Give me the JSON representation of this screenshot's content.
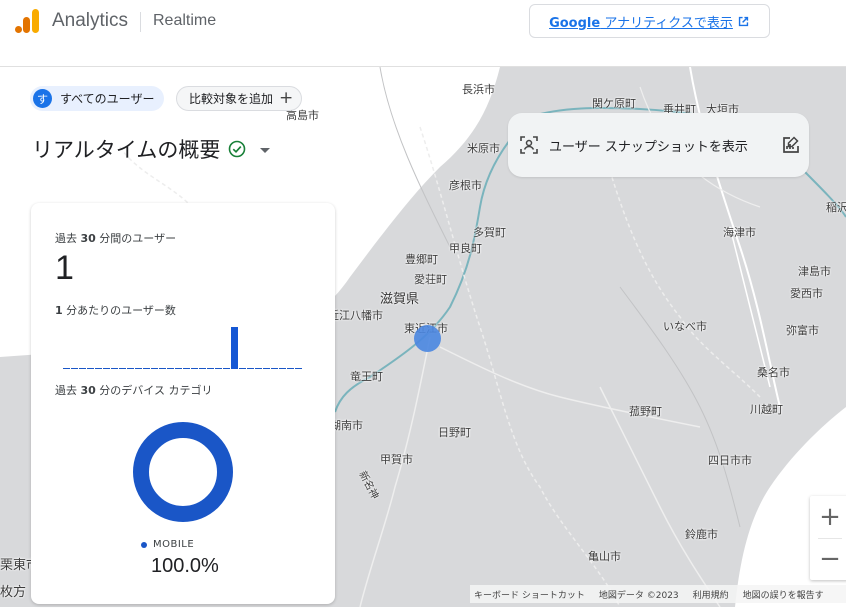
{
  "header": {
    "app_name": "Analytics",
    "view_name": "Realtime",
    "ga_link_bold": "Google",
    "ga_link_rest": " アナリティクスで表示"
  },
  "chips": {
    "all_users_avatar": "す",
    "all_users_label": "すべてのユーザー",
    "add_comparison_label": "比較対象を追加"
  },
  "page": {
    "title": "リアルタイムの概要"
  },
  "snapshot": {
    "label": "ユーザー スナップショットを表示"
  },
  "card": {
    "users_label_pre": "過去 ",
    "users_label_num": "30",
    "users_label_post": " 分間のユーザー",
    "users_value": "1",
    "per_min_num": "1",
    "per_min_label": " 分あたりのユーザー数",
    "device_label_pre": "過去 ",
    "device_label_num": "30",
    "device_label_post": " 分のデバイス カテゴリ",
    "device_legend": "MOBILE",
    "device_pct": "100.0%"
  },
  "chart_data": {
    "type": "bar",
    "title": "1 分あたりのユーザー数",
    "values": [
      0,
      0,
      0,
      0,
      0,
      0,
      0,
      0,
      0,
      0,
      0,
      0,
      0,
      0,
      0,
      0,
      0,
      0,
      0,
      0,
      0,
      1,
      0,
      0,
      0,
      0,
      0,
      0,
      0,
      0
    ]
  },
  "map": {
    "places": [
      {
        "name": "長浜市"
      },
      {
        "name": "関ケ原町"
      },
      {
        "name": "垂井町"
      },
      {
        "name": "大垣市"
      },
      {
        "name": "高島市"
      },
      {
        "name": "米原市"
      },
      {
        "name": "彦根市"
      },
      {
        "name": "多賀町"
      },
      {
        "name": "豊郷町"
      },
      {
        "name": "甲良町"
      },
      {
        "name": "愛荘町"
      },
      {
        "name": "滋賀県"
      },
      {
        "name": "近江八幡市"
      },
      {
        "name": "東近江市"
      },
      {
        "name": "竜王町"
      },
      {
        "name": "湖南市"
      },
      {
        "name": "日野町"
      },
      {
        "name": "甲賀市"
      },
      {
        "name": "いなべ市"
      },
      {
        "name": "海津市"
      },
      {
        "name": "津島市"
      },
      {
        "name": "愛西市"
      },
      {
        "name": "弥富市"
      },
      {
        "name": "桑名市"
      },
      {
        "name": "菰野町"
      },
      {
        "name": "川越町"
      },
      {
        "name": "四日市市"
      },
      {
        "name": "鈴鹿市"
      },
      {
        "name": "亀山市"
      },
      {
        "name": "稲沢"
      },
      {
        "name": "栗東市"
      },
      {
        "name": "枚方"
      },
      {
        "name": "新名神"
      }
    ],
    "attribution": {
      "shortcuts": "キーボード ショートカット",
      "map_data": "地図データ ©2023",
      "terms": "利用規約",
      "report": "地図の誤りを報告す"
    }
  },
  "colors": {
    "accent": "#1a73e8",
    "bar": "#1557d4",
    "donut": "#1a56c7",
    "logo_orange": "#f9ab00",
    "logo_dark": "#e37400"
  }
}
